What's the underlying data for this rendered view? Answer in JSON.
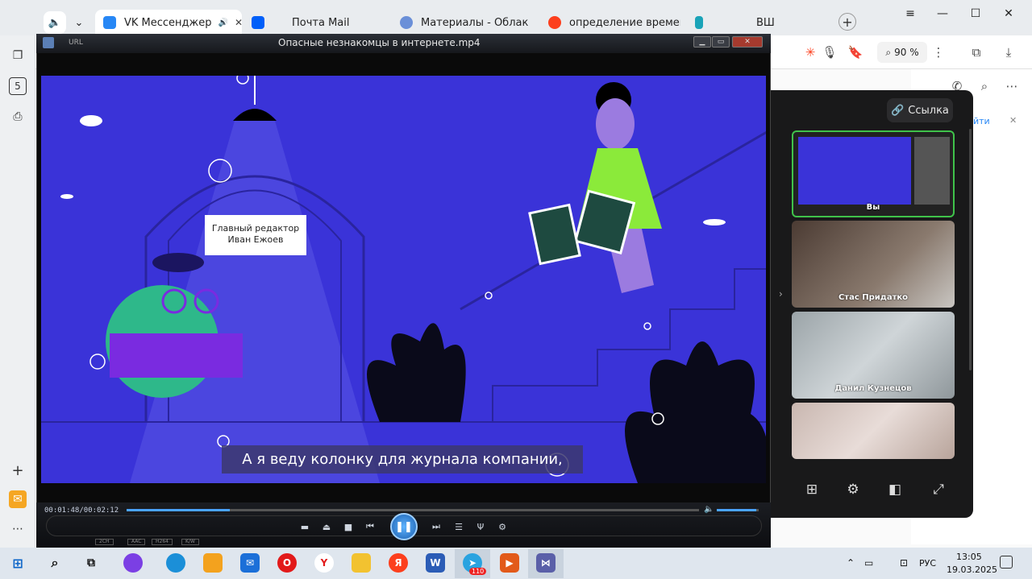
{
  "browser": {
    "tabs": [
      {
        "label": "VK Мессенджер",
        "color": "#2787f5"
      },
      {
        "label": "Почта Mail",
        "color": "#005ff9"
      },
      {
        "label": "Материалы - Облако зна",
        "color": "#6a8fd8"
      },
      {
        "label": "определение времени пе",
        "color": "#fc3f1d"
      },
      {
        "label": "ВШ",
        "color": "#1aa3b8"
      }
    ],
    "zoom": "90 %",
    "sidebar_badge": "5"
  },
  "right_page": {
    "link_text": "йти"
  },
  "player": {
    "title": "Опасные незнакомцы в интернете.mp4",
    "url_label": "URL",
    "time": "00:01:48/00:02:12",
    "progress": 0.18,
    "volume": 0.95,
    "subtitle": "А я веду колонку для журнала компании,",
    "caption_line1": "Главный редактор",
    "caption_line2": "Иван Ежоев",
    "codecs": [
      "2CH",
      "AAC",
      "H264",
      "K/W"
    ]
  },
  "vk_call": {
    "link_label": "Ссылка",
    "participants": [
      {
        "name": "Вы"
      },
      {
        "name": "Стас Придатко"
      },
      {
        "name": "Данил Кузнецов"
      },
      {
        "name": ""
      }
    ]
  },
  "taskbar": {
    "telegram_badge": "110",
    "lang": "РУС",
    "time": "13:05",
    "date": "19.03.2025"
  }
}
